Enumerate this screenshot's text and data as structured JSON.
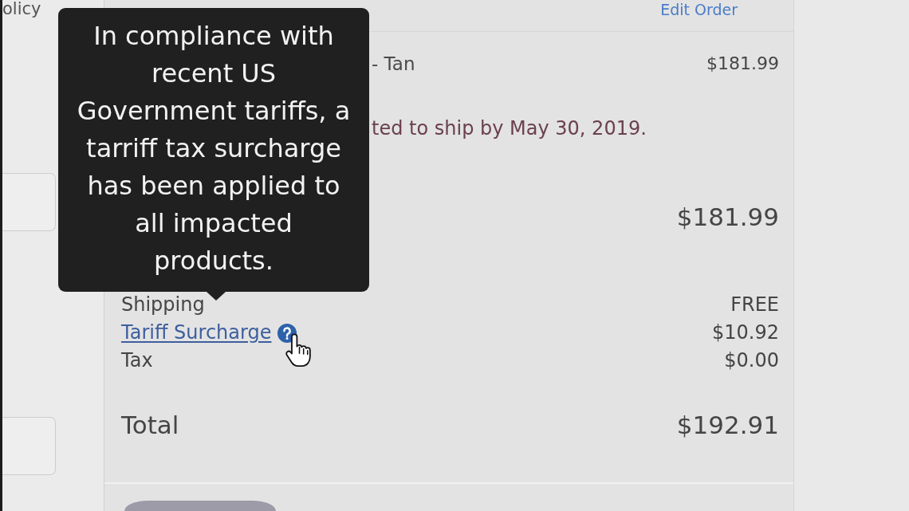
{
  "left_column": {
    "text": "olicy",
    "fields": [
      {
        "kind": "input"
      },
      {
        "kind": "input"
      }
    ]
  },
  "order_summary": {
    "edit_link": "Edit Order",
    "item": {
      "name": "- Tan",
      "price": "$181.99",
      "ship_estimate": "ted to ship by May 30, 2019."
    },
    "subtotal": {
      "value": "$181.99"
    },
    "charges": [
      {
        "kind": "plain",
        "label": "Shipping",
        "value": "FREE"
      },
      {
        "kind": "link",
        "label": "Tariff Surcharge",
        "value": "$10.92"
      },
      {
        "kind": "plain",
        "label": "Tax",
        "value": "$0.00"
      }
    ],
    "total": {
      "label": "Total",
      "value": "$192.91"
    },
    "footer_buttons": [
      {
        "kind": "pill"
      }
    ]
  },
  "tooltip": {
    "text": "In compliance with recent US Government tariffs, a tarriff tax surcharge has been applied to all impacted products."
  }
}
